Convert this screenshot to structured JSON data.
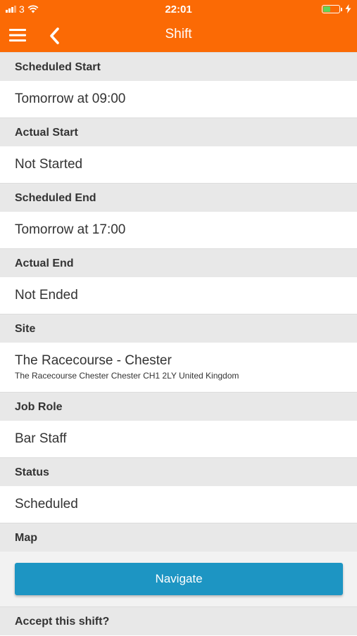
{
  "status_bar": {
    "carrier": "3",
    "time": "22:01"
  },
  "nav": {
    "title": "Shift"
  },
  "sections": {
    "scheduled_start": {
      "label": "Scheduled Start",
      "value": "Tomorrow at 09:00"
    },
    "actual_start": {
      "label": "Actual Start",
      "value": "Not Started"
    },
    "scheduled_end": {
      "label": "Scheduled End",
      "value": "Tomorrow at 17:00"
    },
    "actual_end": {
      "label": "Actual End",
      "value": "Not Ended"
    },
    "site": {
      "label": "Site",
      "value": "The Racecourse - Chester",
      "address": "The Racecourse Chester Chester CH1 2LY United Kingdom"
    },
    "job_role": {
      "label": "Job Role",
      "value": "Bar Staff"
    },
    "status": {
      "label": "Status",
      "value": "Scheduled"
    },
    "map": {
      "label": "Map",
      "button": "Navigate"
    },
    "accept": {
      "label": "Accept this shift?"
    }
  },
  "colors": {
    "header": "#fb6a05",
    "section_bg": "#e8e8e8",
    "button": "#1d95c3",
    "battery": "#5fd35a"
  },
  "icons": [
    "signal-icon",
    "wifi-icon",
    "battery-icon",
    "charging-icon",
    "menu-icon",
    "back-chevron-icon"
  ]
}
